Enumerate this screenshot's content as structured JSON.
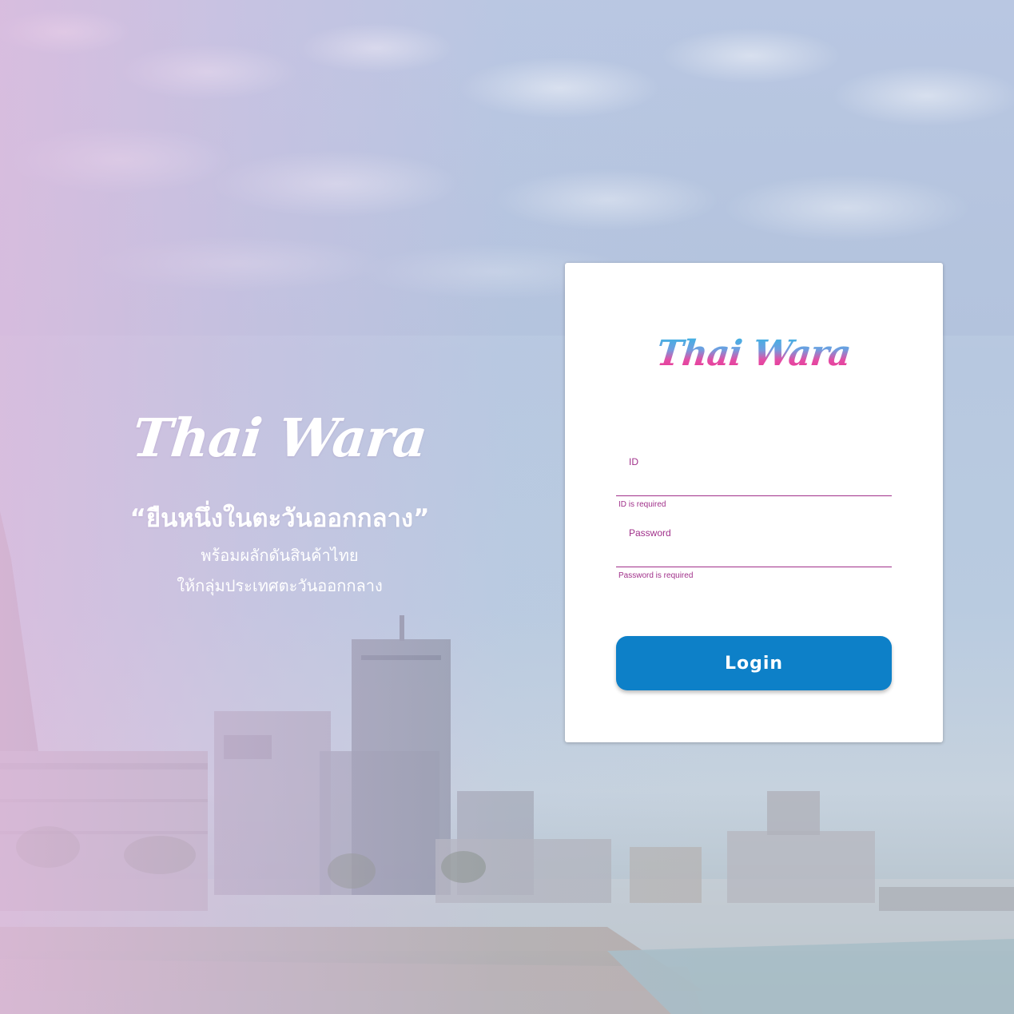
{
  "brand": {
    "name": "Thai Wara",
    "tagline": "“ยืนหนึ่งในตะวันออกกลาง”",
    "subline_1": "พร้อมผลักดันสินค้าไทย",
    "subline_2": "ให้กลุ่มประเทศตะวันออกกลาง"
  },
  "login_card": {
    "logo_text": "Thai Wara",
    "id_field": {
      "label": "ID",
      "value": "",
      "error": "ID is required"
    },
    "password_field": {
      "label": "Password",
      "value": "",
      "error": "Password is required"
    },
    "submit_label": "Login"
  },
  "colors": {
    "accent": "#a0308a",
    "button": "#0d80c8",
    "logo_gradient_top": "#2fb8e4",
    "logo_gradient_bottom": "#ee2e8f"
  }
}
